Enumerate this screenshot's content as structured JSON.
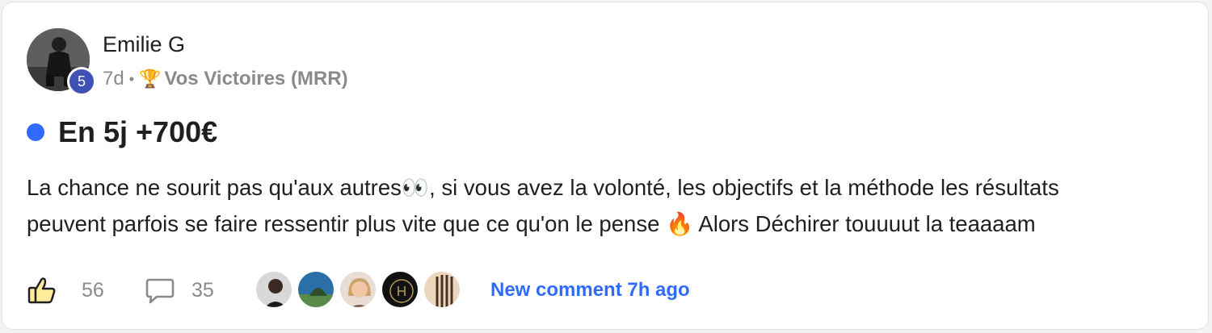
{
  "post": {
    "author": "Emilie G",
    "level": "5",
    "age": "7d",
    "separator": "•",
    "category_icon": "🏆",
    "category": "Vos Victoires (MRR)",
    "title": "En 5j +700€",
    "body_line1": "La chance ne sourit pas qu'aux autres👀, si vous avez la volonté, les objectifs et la méthode les résultats",
    "body_line2": "peuvent parfois se faire ressentir plus vite que ce qu'on le pense 🔥 Alors Déchirer touuuut la teaaaam"
  },
  "footer": {
    "likes": "56",
    "comments": "35",
    "new_comment": "New comment 7h ago",
    "commenter_avatars": [
      "avatar-1",
      "avatar-2",
      "avatar-3",
      "avatar-4",
      "avatar-5"
    ]
  },
  "colors": {
    "accent": "#2f6bff",
    "level_badge": "#3f51b5",
    "muted_text": "#8a8a8a",
    "text": "#1f1f1f"
  }
}
